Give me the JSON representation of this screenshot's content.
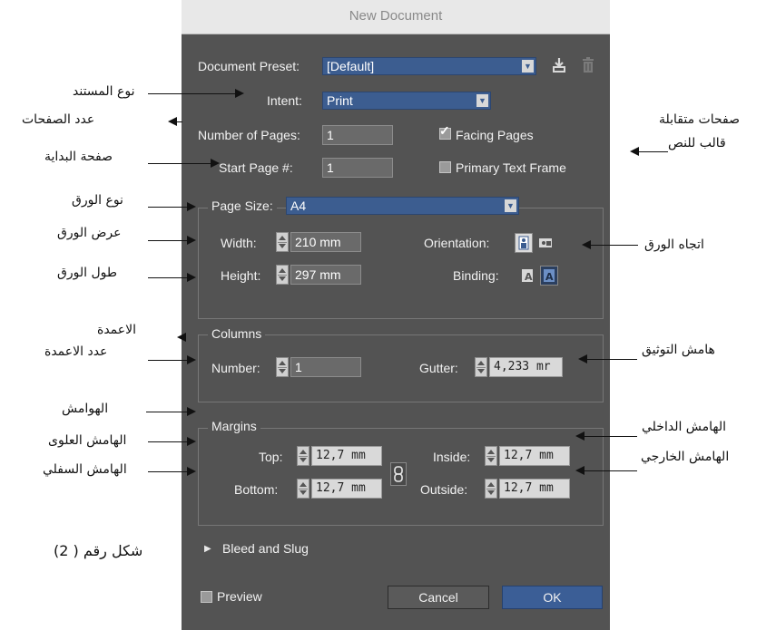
{
  "dialog": {
    "title": "New Document",
    "preset": {
      "label": "Document Preset:",
      "value": "[Default]"
    },
    "intent": {
      "label": "Intent:",
      "value": "Print"
    },
    "pages": {
      "label": "Number of Pages:",
      "value": "1"
    },
    "start_page": {
      "label": "Start Page #:",
      "value": "1"
    },
    "facing_pages": {
      "label": "Facing Pages",
      "checked": true
    },
    "primary_text_frame": {
      "label": "Primary Text Frame",
      "checked": false
    },
    "page_size": {
      "label": "Page Size:",
      "value": "A4"
    },
    "width": {
      "label": "Width:",
      "value": "210 mm"
    },
    "height": {
      "label": "Height:",
      "value": "297 mm"
    },
    "orientation": {
      "label": "Orientation:"
    },
    "binding": {
      "label": "Binding:"
    },
    "columns": {
      "legend": "Columns",
      "number_label": "Number:",
      "number_value": "1",
      "gutter_label": "Gutter:",
      "gutter_value": "4,233 mr"
    },
    "margins": {
      "legend": "Margins",
      "top_label": "Top:",
      "top_value": "12,7 mm",
      "bottom_label": "Bottom:",
      "bottom_value": "12,7 mm",
      "inside_label": "Inside:",
      "inside_value": "12,7 mm",
      "outside_label": "Outside:",
      "outside_value": "12,7 mm"
    },
    "bleed": {
      "label": "Bleed and Slug"
    },
    "preview": {
      "label": "Preview",
      "checked": false
    },
    "cancel_label": "Cancel",
    "ok_label": "OK"
  },
  "annotations": {
    "doc_type": "نوع المستند",
    "page_count": "عدد الصفحات",
    "start_page": "صفحة البداية",
    "paper_type": "نوع الورق",
    "paper_width": "عرض الورق",
    "paper_height": "طول الورق",
    "columns": "الاعمدة",
    "column_count": "عدد الاعمدة",
    "margins": "الهوامش",
    "top_margin": "الهامش العلوى",
    "bottom_margin": "الهامش السفلي",
    "facing_pages": "صفحات متقابلة",
    "text_frame": "قالب للنص",
    "orientation": "اتجاه الورق",
    "gutter": "هامش التوثيق",
    "inside_margin": "الهامش الداخلي",
    "outside_margin": "الهامش الخارجي",
    "figure_caption": "شكل رقم ( 2)"
  },
  "colors": {
    "dialog_bg": "#535353",
    "accent": "#3c5d90",
    "titlebar": "#e8e8e8"
  },
  "icons": [
    "chevron-down-icon",
    "save-preset-icon",
    "trash-icon",
    "checkbox-icon",
    "stepper-icon",
    "portrait-icon",
    "landscape-icon",
    "binding-left-icon",
    "binding-right-icon",
    "link-icon",
    "disclosure-triangle-icon"
  ]
}
